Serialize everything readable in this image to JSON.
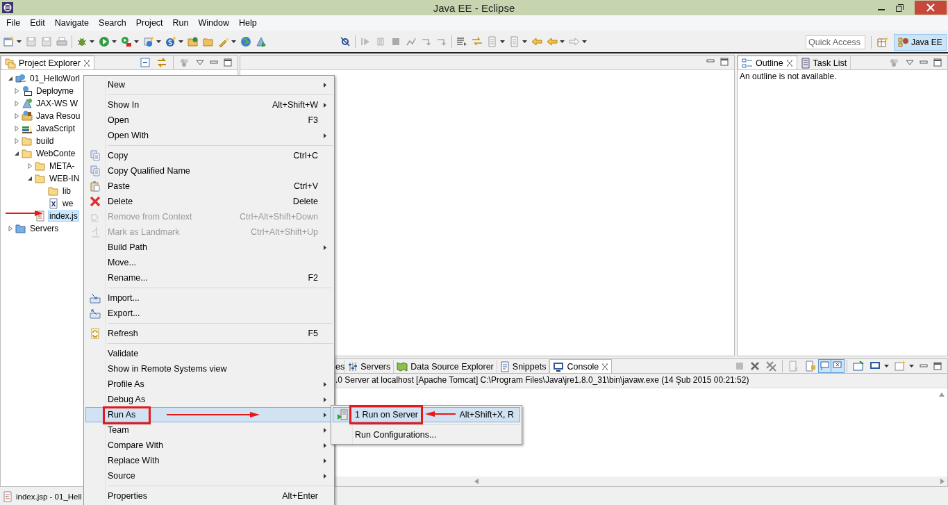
{
  "window": {
    "title": "Java EE - Eclipse"
  },
  "menu_bar": [
    "File",
    "Edit",
    "Navigate",
    "Search",
    "Project",
    "Run",
    "Window",
    "Help"
  ],
  "quick_access": {
    "placeholder": "Quick Access"
  },
  "perspective": {
    "label": "Java EE",
    "selected": true
  },
  "project_explorer": {
    "tab": {
      "label": "Project Explorer",
      "selected": true
    },
    "tree": [
      {
        "label": "01_HelloWorl",
        "kind": "project",
        "expanded": true,
        "selected": false,
        "children": [
          {
            "label": "Deployme",
            "kind": "deployment",
            "expanded": false,
            "selected": false
          },
          {
            "label": "JAX-WS W",
            "kind": "webservice",
            "expanded": false,
            "selected": false
          },
          {
            "label": "Java Resou",
            "kind": "resources",
            "expanded": false,
            "selected": false
          },
          {
            "label": "JavaScript",
            "kind": "library",
            "expanded": false,
            "selected": false
          },
          {
            "label": "build",
            "kind": "folder",
            "expanded": false,
            "selected": false
          },
          {
            "label": "WebConte",
            "kind": "folder",
            "expanded": true,
            "selected": false,
            "children": [
              {
                "label": "META-",
                "kind": "folder",
                "expanded": false,
                "selected": false
              },
              {
                "label": "WEB-IN",
                "kind": "folder",
                "expanded": true,
                "selected": false,
                "children": [
                  {
                    "label": "lib",
                    "kind": "folder",
                    "selected": false
                  },
                  {
                    "label": "we",
                    "kind": "xml",
                    "selected": false
                  }
                ]
              },
              {
                "label": "index.js",
                "kind": "jsp",
                "selected": true
              }
            ]
          }
        ]
      },
      {
        "label": "Servers",
        "kind": "servers",
        "expanded": false,
        "selected": false
      }
    ]
  },
  "outline": {
    "tabs": [
      {
        "label": "Outline",
        "selected": true
      },
      {
        "label": "Task List",
        "selected": false
      }
    ],
    "message": "An outline is not available."
  },
  "console": {
    "tabs": [
      {
        "label": "es",
        "selected": false
      },
      {
        "label": "Servers",
        "selected": false
      },
      {
        "label": "Data Source Explorer",
        "selected": false
      },
      {
        "label": "Snippets",
        "selected": false
      },
      {
        "label": "Console",
        "selected": true
      }
    ],
    "description": ".0 Server at localhost [Apache Tomcat] C:\\Program Files\\Java\\jre1.8.0_31\\bin\\javaw.exe (14 Şub 2015 00:21:52)"
  },
  "context_menu": [
    {
      "kind": "item",
      "label": "New",
      "submenu": true,
      "disabled": false,
      "selected": false
    },
    {
      "kind": "separator"
    },
    {
      "kind": "item",
      "label": "Show In",
      "shortcut": "Alt+Shift+W",
      "submenu": true,
      "disabled": false,
      "selected": false
    },
    {
      "kind": "item",
      "label": "Open",
      "shortcut": "F3",
      "submenu": false,
      "disabled": false,
      "selected": false
    },
    {
      "kind": "item",
      "label": "Open With",
      "submenu": true,
      "disabled": false,
      "selected": false
    },
    {
      "kind": "separator"
    },
    {
      "kind": "item",
      "label": "Copy",
      "shortcut": "Ctrl+C",
      "submenu": false,
      "disabled": false,
      "selected": false
    },
    {
      "kind": "item",
      "label": "Copy Qualified Name",
      "submenu": false,
      "disabled": false,
      "selected": false
    },
    {
      "kind": "item",
      "label": "Paste",
      "shortcut": "Ctrl+V",
      "submenu": false,
      "disabled": false,
      "selected": false
    },
    {
      "kind": "item",
      "label": "Delete",
      "shortcut": "Delete",
      "submenu": false,
      "disabled": false,
      "selected": false
    },
    {
      "kind": "item",
      "label": "Remove from Context",
      "shortcut": "Ctrl+Alt+Shift+Down",
      "submenu": false,
      "disabled": true,
      "selected": false
    },
    {
      "kind": "item",
      "label": "Mark as Landmark",
      "shortcut": "Ctrl+Alt+Shift+Up",
      "submenu": false,
      "disabled": true,
      "selected": false
    },
    {
      "kind": "item",
      "label": "Build Path",
      "submenu": true,
      "disabled": false,
      "selected": false
    },
    {
      "kind": "item",
      "label": "Move...",
      "submenu": false,
      "disabled": false,
      "selected": false
    },
    {
      "kind": "item",
      "label": "Rename...",
      "shortcut": "F2",
      "submenu": false,
      "disabled": false,
      "selected": false
    },
    {
      "kind": "separator"
    },
    {
      "kind": "item",
      "label": "Import...",
      "submenu": false,
      "disabled": false,
      "selected": false
    },
    {
      "kind": "item",
      "label": "Export...",
      "submenu": false,
      "disabled": false,
      "selected": false
    },
    {
      "kind": "separator"
    },
    {
      "kind": "item",
      "label": "Refresh",
      "shortcut": "F5",
      "submenu": false,
      "disabled": false,
      "selected": false
    },
    {
      "kind": "separator"
    },
    {
      "kind": "item",
      "label": "Validate",
      "submenu": false,
      "disabled": false,
      "selected": false
    },
    {
      "kind": "item",
      "label": "Show in Remote Systems view",
      "submenu": false,
      "disabled": false,
      "selected": false
    },
    {
      "kind": "item",
      "label": "Profile As",
      "submenu": true,
      "disabled": false,
      "selected": false
    },
    {
      "kind": "item",
      "label": "Debug As",
      "submenu": true,
      "disabled": false,
      "selected": false
    },
    {
      "kind": "item",
      "label": "Run As",
      "submenu": true,
      "disabled": false,
      "selected": true
    },
    {
      "kind": "item",
      "label": "Team",
      "submenu": true,
      "disabled": false,
      "selected": false
    },
    {
      "kind": "item",
      "label": "Compare With",
      "submenu": true,
      "disabled": false,
      "selected": false
    },
    {
      "kind": "item",
      "label": "Replace With",
      "submenu": true,
      "disabled": false,
      "selected": false
    },
    {
      "kind": "item",
      "label": "Source",
      "submenu": true,
      "disabled": false,
      "selected": false
    },
    {
      "kind": "separator"
    },
    {
      "kind": "item",
      "label": "Properties",
      "shortcut": "Alt+Enter",
      "submenu": false,
      "disabled": false,
      "selected": false
    }
  ],
  "run_as_submenu": [
    {
      "kind": "item",
      "label": "1 Run on Server",
      "shortcut": "Alt+Shift+X, R",
      "selected": true
    },
    {
      "kind": "separator"
    },
    {
      "kind": "item",
      "label": "Run Configurations...",
      "selected": false
    }
  ],
  "status_bar": {
    "text": "index.jsp - 01_Hell"
  }
}
